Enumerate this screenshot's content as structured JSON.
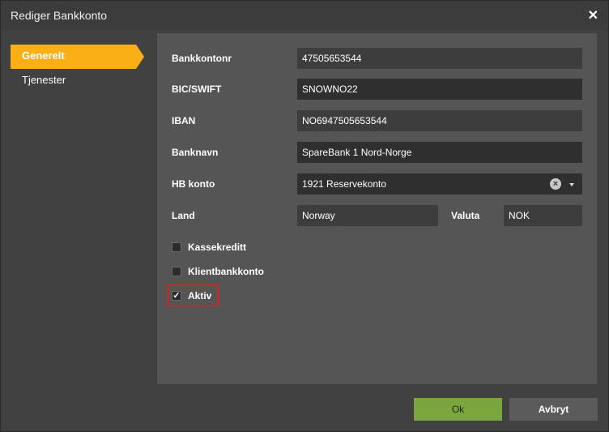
{
  "dialog": {
    "title": "Rediger Bankkonto"
  },
  "nav": {
    "items": [
      {
        "label": "Generelt"
      },
      {
        "label": "Tjenester"
      }
    ]
  },
  "form": {
    "account_number": {
      "label": "Bankkontonr",
      "value": "47505653544"
    },
    "bic": {
      "label": "BIC/SWIFT",
      "value": "SNOWNO22"
    },
    "iban": {
      "label": "IBAN",
      "value": "NO6947505653544"
    },
    "bank_name": {
      "label": "Banknavn",
      "value": "SpareBank 1 Nord-Norge"
    },
    "hb_account": {
      "label": "HB konto",
      "value": "1921 Reservekonto"
    },
    "country": {
      "label": "Land",
      "value": "Norway"
    },
    "currency": {
      "label": "Valuta",
      "value": "NOK"
    },
    "checkboxes": [
      {
        "label": "Kassekreditt",
        "checked": false
      },
      {
        "label": "Klientbankkonto",
        "checked": false
      },
      {
        "label": "Aktiv",
        "checked": true
      }
    ]
  },
  "footer": {
    "ok_label": "Ok",
    "cancel_label": "Avbryt"
  },
  "colors": {
    "accent": "#fbaf16",
    "ok": "#7aa63d",
    "highlight": "#e01e1e"
  }
}
